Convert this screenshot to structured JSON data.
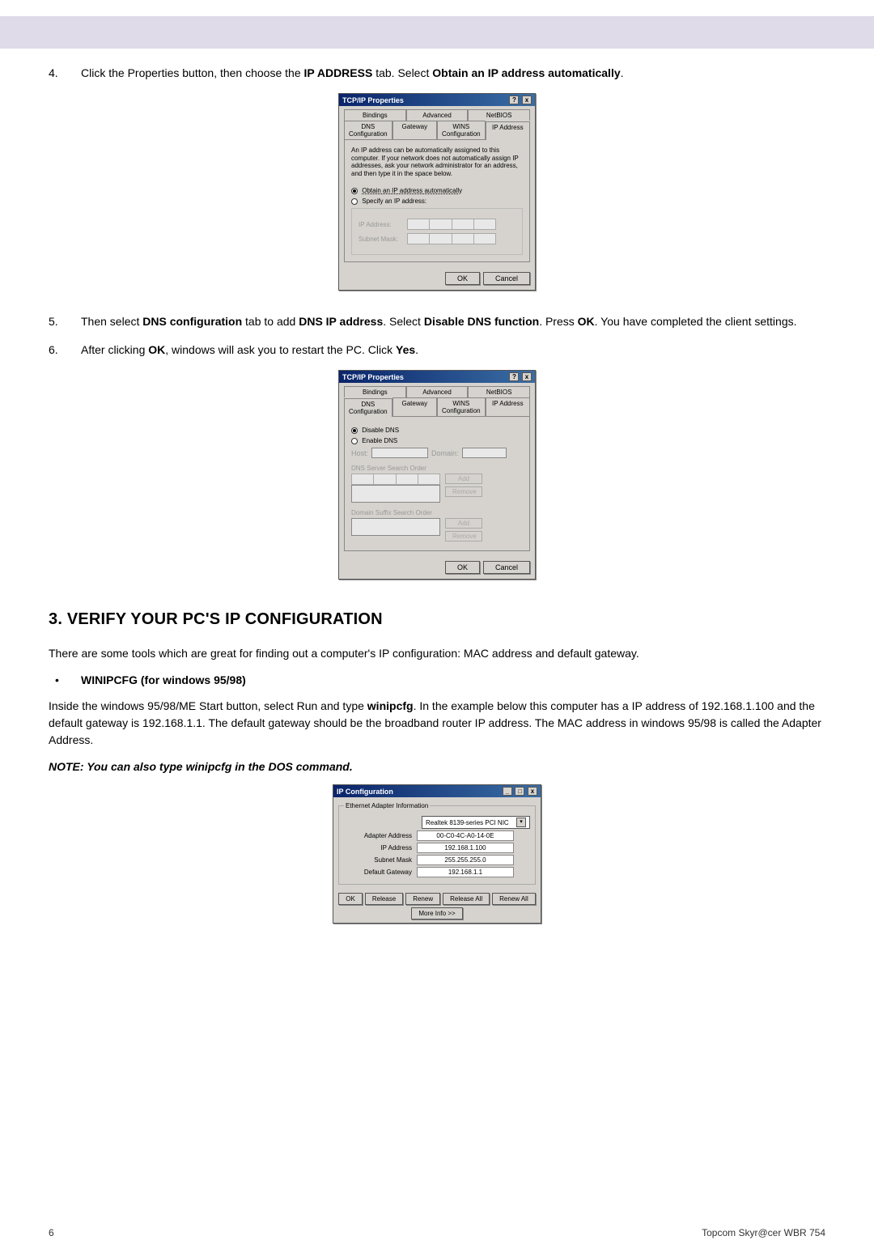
{
  "header": {},
  "steps": {
    "s4": {
      "num": "4.",
      "text_a": "Click the Properties button, then choose the ",
      "text_b": "IP ADDRESS",
      "text_c": " tab. Select ",
      "text_d": "Obtain an IP address automatically",
      "text_e": "."
    },
    "s5": {
      "num": "5.",
      "text_a": "Then select ",
      "text_b": "DNS configuration",
      "text_c": " tab to add ",
      "text_d": "DNS IP address",
      "text_e": ". Select ",
      "text_f": "Disable DNS function",
      "text_g": ". Press ",
      "text_h": "OK",
      "text_i": ". You have completed the client settings."
    },
    "s6": {
      "num": "6.",
      "text_a": "After clicking ",
      "text_b": "OK",
      "text_c": ", windows will ask you to restart the PC. Click ",
      "text_d": "Yes",
      "text_e": "."
    }
  },
  "tcpip1": {
    "title": "TCP/IP Properties",
    "help_btn": "?",
    "close_btn": "x",
    "tabs_row1": [
      "Bindings",
      "Advanced",
      "NetBIOS"
    ],
    "tabs_row2": [
      "DNS Configuration",
      "Gateway",
      "WINS Configuration",
      "IP Address"
    ],
    "msg": "An IP address can be automatically assigned to this computer. If your network does not automatically assign IP addresses, ask your network administrator for an address, and then type it in the space below.",
    "opt1": "Obtain an IP address automatically",
    "opt2": "Specify an IP address:",
    "ip_lbl": "IP Address:",
    "mask_lbl": "Subnet Mask:",
    "ok": "OK",
    "cancel": "Cancel"
  },
  "tcpip2": {
    "title": "TCP/IP Properties",
    "help_btn": "?",
    "close_btn": "x",
    "tabs_row1": [
      "Bindings",
      "Advanced",
      "NetBIOS"
    ],
    "tabs_row2": [
      "DNS Configuration",
      "Gateway",
      "WINS Configuration",
      "IP Address"
    ],
    "disable": "Disable DNS",
    "enable": "Enable DNS",
    "host_lbl": "Host:",
    "domain_lbl": "Domain:",
    "search_order": "DNS Server Search Order",
    "suffix_order": "Domain Suffix Search Order",
    "add": "Add",
    "remove": "Remove",
    "ok": "OK",
    "cancel": "Cancel"
  },
  "section3": {
    "heading": "3.  VERIFY YOUR PC'S IP CONFIGURATION",
    "intro": "There are some tools which are great for finding out a computer's IP configuration: MAC address and default gateway.",
    "bullet_dot": "•",
    "bullet": "WINIPCFG (for windows 95/98)",
    "p1_a": "Inside the windows 95/98/ME Start button, select Run and type ",
    "p1_b": "winipcfg",
    "p1_c": ". In the example below this computer has a IP address of 192.168.1.100 and the default gateway is 192.168.1.1. The default gateway should be the broadband router IP address. The MAC address in windows 95/98 is called the Adapter Address.",
    "note": "NOTE: You can also type winipcfg in the DOS command."
  },
  "ipcfg": {
    "title": "IP Configuration",
    "min_btn": "_",
    "max_btn": "□",
    "close_btn": "x",
    "group_label": "Ethernet Adapter Information",
    "adapter_select": "Realtek 8139-series PCI NIC",
    "rows": {
      "adapter_addr_lbl": "Adapter Address",
      "adapter_addr_val": "00-C0-4C-A0-14-0E",
      "ip_lbl": "IP Address",
      "ip_val": "192.168.1.100",
      "mask_lbl": "Subnet Mask",
      "mask_val": "255.255.255.0",
      "gw_lbl": "Default Gateway",
      "gw_val": "192.168.1.1"
    },
    "btns": {
      "ok": "OK",
      "release": "Release",
      "renew": "Renew",
      "release_all": "Release All",
      "renew_all": "Renew All",
      "more": "More Info >>"
    }
  },
  "footer": {
    "page": "6",
    "product": "Topcom Skyr@cer WBR 754"
  }
}
